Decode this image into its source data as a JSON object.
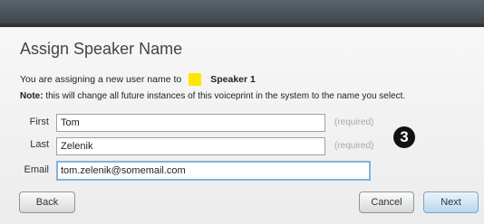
{
  "dialog": {
    "title": "Assign Speaker Name",
    "message_prefix": "You are assigning a new user name to",
    "speaker_name": "Speaker 1",
    "speaker_color": "#ffe600",
    "note_label": "Note:",
    "note_text": "this will change all future instances of this voiceprint in the system to the name you select.",
    "step_badge": "3"
  },
  "form": {
    "first": {
      "label": "First",
      "value": "Tom",
      "hint": "(required)"
    },
    "last": {
      "label": "Last",
      "value": "Zelenik",
      "hint": "(required)"
    },
    "email": {
      "label": "Email",
      "value": "tom.zelenik@somemail.com"
    }
  },
  "buttons": {
    "back": "Back",
    "cancel": "Cancel",
    "next": "Next"
  }
}
